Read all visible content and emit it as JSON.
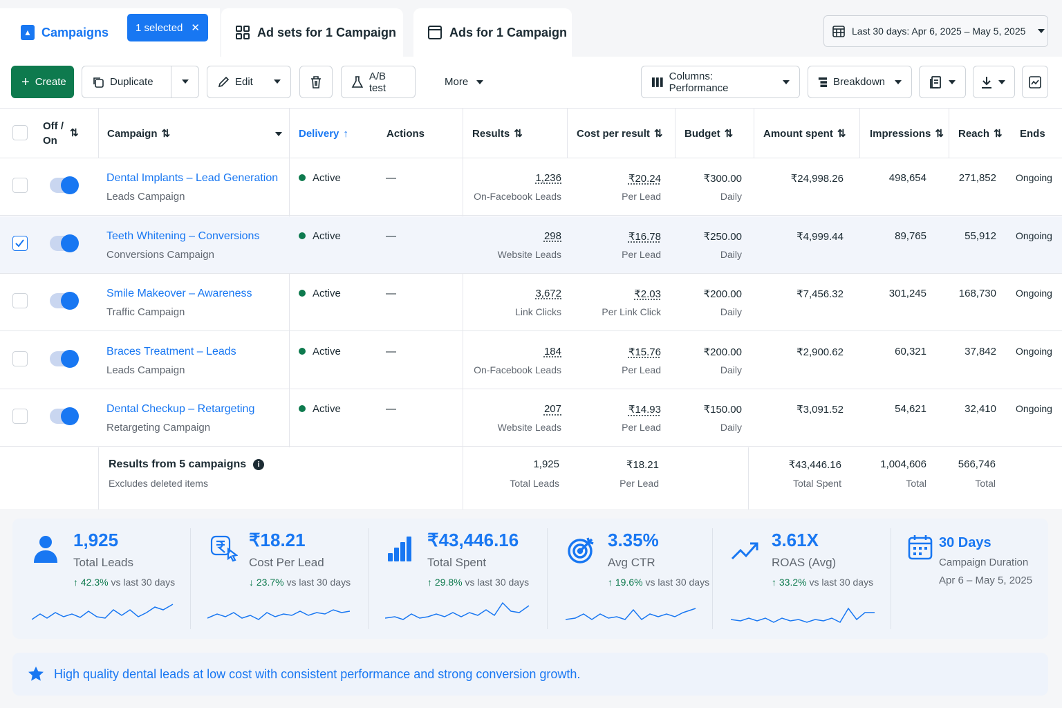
{
  "tabs": {
    "campaigns": "Campaigns",
    "selected": "1 selected",
    "adsets": "Ad sets for 1 Campaign",
    "ads": "Ads for 1 Campaign"
  },
  "date_range": "Last 30 days: Apr 6, 2025 – May 5, 2025",
  "toolbar": {
    "create": "Create",
    "duplicate": "Duplicate",
    "edit": "Edit",
    "ab_test": "A/B test",
    "more": "More",
    "columns": "Columns: Performance",
    "breakdown": "Breakdown"
  },
  "columns": {
    "off_on": "Off / On",
    "campaign": "Campaign",
    "delivery": "Delivery",
    "actions": "Actions",
    "results": "Results",
    "cost_per_result": "Cost per result",
    "budget": "Budget",
    "amount_spent": "Amount spent",
    "impressions": "Impressions",
    "reach": "Reach",
    "ends": "Ends"
  },
  "rows": [
    {
      "name": "Dental Implants – Lead Generation",
      "type": "Leads Campaign",
      "delivery": "Active",
      "actions": "—",
      "results": "1,236",
      "results_sub": "On-Facebook Leads",
      "cpr": "₹20.24",
      "cpr_sub": "Per Lead",
      "budget": "₹300.00",
      "budget_sub": "Daily",
      "spent": "₹24,998.26",
      "impressions": "498,654",
      "reach": "271,852",
      "ends": "Ongoing"
    },
    {
      "name": "Teeth Whitening – Conversions",
      "type": "Conversions Campaign",
      "delivery": "Active",
      "actions": "—",
      "results": "298",
      "results_sub": "Website Leads",
      "cpr": "₹16.78",
      "cpr_sub": "Per Lead",
      "budget": "₹250.00",
      "budget_sub": "Daily",
      "spent": "₹4,999.44",
      "impressions": "89,765",
      "reach": "55,912",
      "ends": "Ongoing"
    },
    {
      "name": "Smile Makeover – Awareness",
      "type": "Traffic Campaign",
      "delivery": "Active",
      "actions": "—",
      "results": "3,672",
      "results_sub": "Link Clicks",
      "cpr": "₹2.03",
      "cpr_sub": "Per Link Click",
      "budget": "₹200.00",
      "budget_sub": "Daily",
      "spent": "₹7,456.32",
      "impressions": "301,245",
      "reach": "168,730",
      "ends": "Ongoing"
    },
    {
      "name": "Braces Treatment – Leads",
      "type": "Leads Campaign",
      "delivery": "Active",
      "actions": "—",
      "results": "184",
      "results_sub": "On-Facebook Leads",
      "cpr": "₹15.76",
      "cpr_sub": "Per Lead",
      "budget": "₹200.00",
      "budget_sub": "Daily",
      "spent": "₹2,900.62",
      "impressions": "60,321",
      "reach": "37,842",
      "ends": "Ongoing"
    },
    {
      "name": "Dental Checkup – Retargeting",
      "type": "Retargeting Campaign",
      "delivery": "Active",
      "actions": "—",
      "results": "207",
      "results_sub": "Website Leads",
      "cpr": "₹14.93",
      "cpr_sub": "Per Lead",
      "budget": "₹150.00",
      "budget_sub": "Daily",
      "spent": "₹3,091.52",
      "impressions": "54,621",
      "reach": "32,410",
      "ends": "Ongoing"
    }
  ],
  "totals": {
    "title": "Results from 5 campaigns",
    "subtitle": "Excludes deleted items",
    "results": "1,925",
    "results_sub": "Total Leads",
    "cpr": "₹18.21",
    "cpr_sub": "Per Lead",
    "spent": "₹43,446.16",
    "spent_sub": "Total Spent",
    "impressions": "1,004,606",
    "impressions_sub": "Total",
    "reach": "566,746",
    "reach_sub": "Total"
  },
  "cards": [
    {
      "value": "1,925",
      "label": "Total Leads",
      "change": "42.3%",
      "dir": "↑",
      "suffix": "vs last 30 days",
      "icon": "users-icon"
    },
    {
      "value": "₹18.21",
      "label": "Cost Per Lead",
      "change": "23.7%",
      "dir": "↓",
      "suffix": "vs last 30 days",
      "icon": "rupee-click-icon"
    },
    {
      "value": "₹43,446.16",
      "label": "Total Spent",
      "change": "29.8%",
      "dir": "↑",
      "suffix": "vs last 30 days",
      "icon": "bar-chart-icon"
    },
    {
      "value": "3.35%",
      "label": "Avg CTR",
      "change": "19.6%",
      "dir": "↑",
      "suffix": "vs last 30 days",
      "icon": "target-icon"
    },
    {
      "value": "3.61X",
      "label": "ROAS (Avg)",
      "change": "33.2%",
      "dir": "↑",
      "suffix": "vs last 30 days",
      "icon": "trend-up-icon"
    },
    {
      "value": "30 Days",
      "label": "Campaign Duration",
      "range": "Apr 6 – May 5, 2025",
      "icon": "calendar-icon"
    }
  ],
  "colors": {
    "accent": "#1877f2",
    "create": "#0e7a4e",
    "active": "#0e7a4e"
  },
  "note": "High quality dental leads at low cost with consistent performance and strong conversion growth."
}
